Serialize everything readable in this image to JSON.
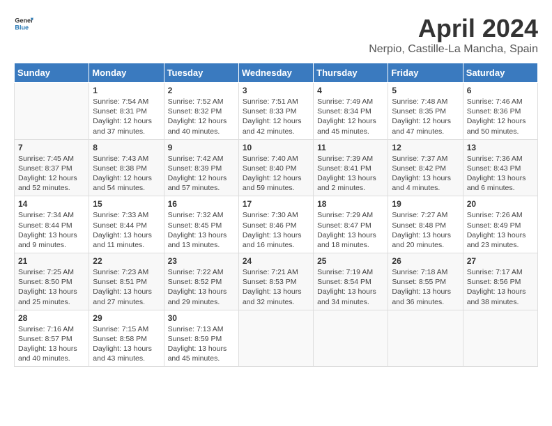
{
  "header": {
    "logo_general": "General",
    "logo_blue": "Blue",
    "title": "April 2024",
    "location": "Nerpio, Castille-La Mancha, Spain"
  },
  "days_of_week": [
    "Sunday",
    "Monday",
    "Tuesday",
    "Wednesday",
    "Thursday",
    "Friday",
    "Saturday"
  ],
  "weeks": [
    [
      {
        "day": "",
        "content": ""
      },
      {
        "day": "1",
        "content": "Sunrise: 7:54 AM\nSunset: 8:31 PM\nDaylight: 12 hours and 37 minutes."
      },
      {
        "day": "2",
        "content": "Sunrise: 7:52 AM\nSunset: 8:32 PM\nDaylight: 12 hours and 40 minutes."
      },
      {
        "day": "3",
        "content": "Sunrise: 7:51 AM\nSunset: 8:33 PM\nDaylight: 12 hours and 42 minutes."
      },
      {
        "day": "4",
        "content": "Sunrise: 7:49 AM\nSunset: 8:34 PM\nDaylight: 12 hours and 45 minutes."
      },
      {
        "day": "5",
        "content": "Sunrise: 7:48 AM\nSunset: 8:35 PM\nDaylight: 12 hours and 47 minutes."
      },
      {
        "day": "6",
        "content": "Sunrise: 7:46 AM\nSunset: 8:36 PM\nDaylight: 12 hours and 50 minutes."
      }
    ],
    [
      {
        "day": "7",
        "content": "Sunrise: 7:45 AM\nSunset: 8:37 PM\nDaylight: 12 hours and 52 minutes."
      },
      {
        "day": "8",
        "content": "Sunrise: 7:43 AM\nSunset: 8:38 PM\nDaylight: 12 hours and 54 minutes."
      },
      {
        "day": "9",
        "content": "Sunrise: 7:42 AM\nSunset: 8:39 PM\nDaylight: 12 hours and 57 minutes."
      },
      {
        "day": "10",
        "content": "Sunrise: 7:40 AM\nSunset: 8:40 PM\nDaylight: 12 hours and 59 minutes."
      },
      {
        "day": "11",
        "content": "Sunrise: 7:39 AM\nSunset: 8:41 PM\nDaylight: 13 hours and 2 minutes."
      },
      {
        "day": "12",
        "content": "Sunrise: 7:37 AM\nSunset: 8:42 PM\nDaylight: 13 hours and 4 minutes."
      },
      {
        "day": "13",
        "content": "Sunrise: 7:36 AM\nSunset: 8:43 PM\nDaylight: 13 hours and 6 minutes."
      }
    ],
    [
      {
        "day": "14",
        "content": "Sunrise: 7:34 AM\nSunset: 8:44 PM\nDaylight: 13 hours and 9 minutes."
      },
      {
        "day": "15",
        "content": "Sunrise: 7:33 AM\nSunset: 8:44 PM\nDaylight: 13 hours and 11 minutes."
      },
      {
        "day": "16",
        "content": "Sunrise: 7:32 AM\nSunset: 8:45 PM\nDaylight: 13 hours and 13 minutes."
      },
      {
        "day": "17",
        "content": "Sunrise: 7:30 AM\nSunset: 8:46 PM\nDaylight: 13 hours and 16 minutes."
      },
      {
        "day": "18",
        "content": "Sunrise: 7:29 AM\nSunset: 8:47 PM\nDaylight: 13 hours and 18 minutes."
      },
      {
        "day": "19",
        "content": "Sunrise: 7:27 AM\nSunset: 8:48 PM\nDaylight: 13 hours and 20 minutes."
      },
      {
        "day": "20",
        "content": "Sunrise: 7:26 AM\nSunset: 8:49 PM\nDaylight: 13 hours and 23 minutes."
      }
    ],
    [
      {
        "day": "21",
        "content": "Sunrise: 7:25 AM\nSunset: 8:50 PM\nDaylight: 13 hours and 25 minutes."
      },
      {
        "day": "22",
        "content": "Sunrise: 7:23 AM\nSunset: 8:51 PM\nDaylight: 13 hours and 27 minutes."
      },
      {
        "day": "23",
        "content": "Sunrise: 7:22 AM\nSunset: 8:52 PM\nDaylight: 13 hours and 29 minutes."
      },
      {
        "day": "24",
        "content": "Sunrise: 7:21 AM\nSunset: 8:53 PM\nDaylight: 13 hours and 32 minutes."
      },
      {
        "day": "25",
        "content": "Sunrise: 7:19 AM\nSunset: 8:54 PM\nDaylight: 13 hours and 34 minutes."
      },
      {
        "day": "26",
        "content": "Sunrise: 7:18 AM\nSunset: 8:55 PM\nDaylight: 13 hours and 36 minutes."
      },
      {
        "day": "27",
        "content": "Sunrise: 7:17 AM\nSunset: 8:56 PM\nDaylight: 13 hours and 38 minutes."
      }
    ],
    [
      {
        "day": "28",
        "content": "Sunrise: 7:16 AM\nSunset: 8:57 PM\nDaylight: 13 hours and 40 minutes."
      },
      {
        "day": "29",
        "content": "Sunrise: 7:15 AM\nSunset: 8:58 PM\nDaylight: 13 hours and 43 minutes."
      },
      {
        "day": "30",
        "content": "Sunrise: 7:13 AM\nSunset: 8:59 PM\nDaylight: 13 hours and 45 minutes."
      },
      {
        "day": "",
        "content": ""
      },
      {
        "day": "",
        "content": ""
      },
      {
        "day": "",
        "content": ""
      },
      {
        "day": "",
        "content": ""
      }
    ]
  ]
}
